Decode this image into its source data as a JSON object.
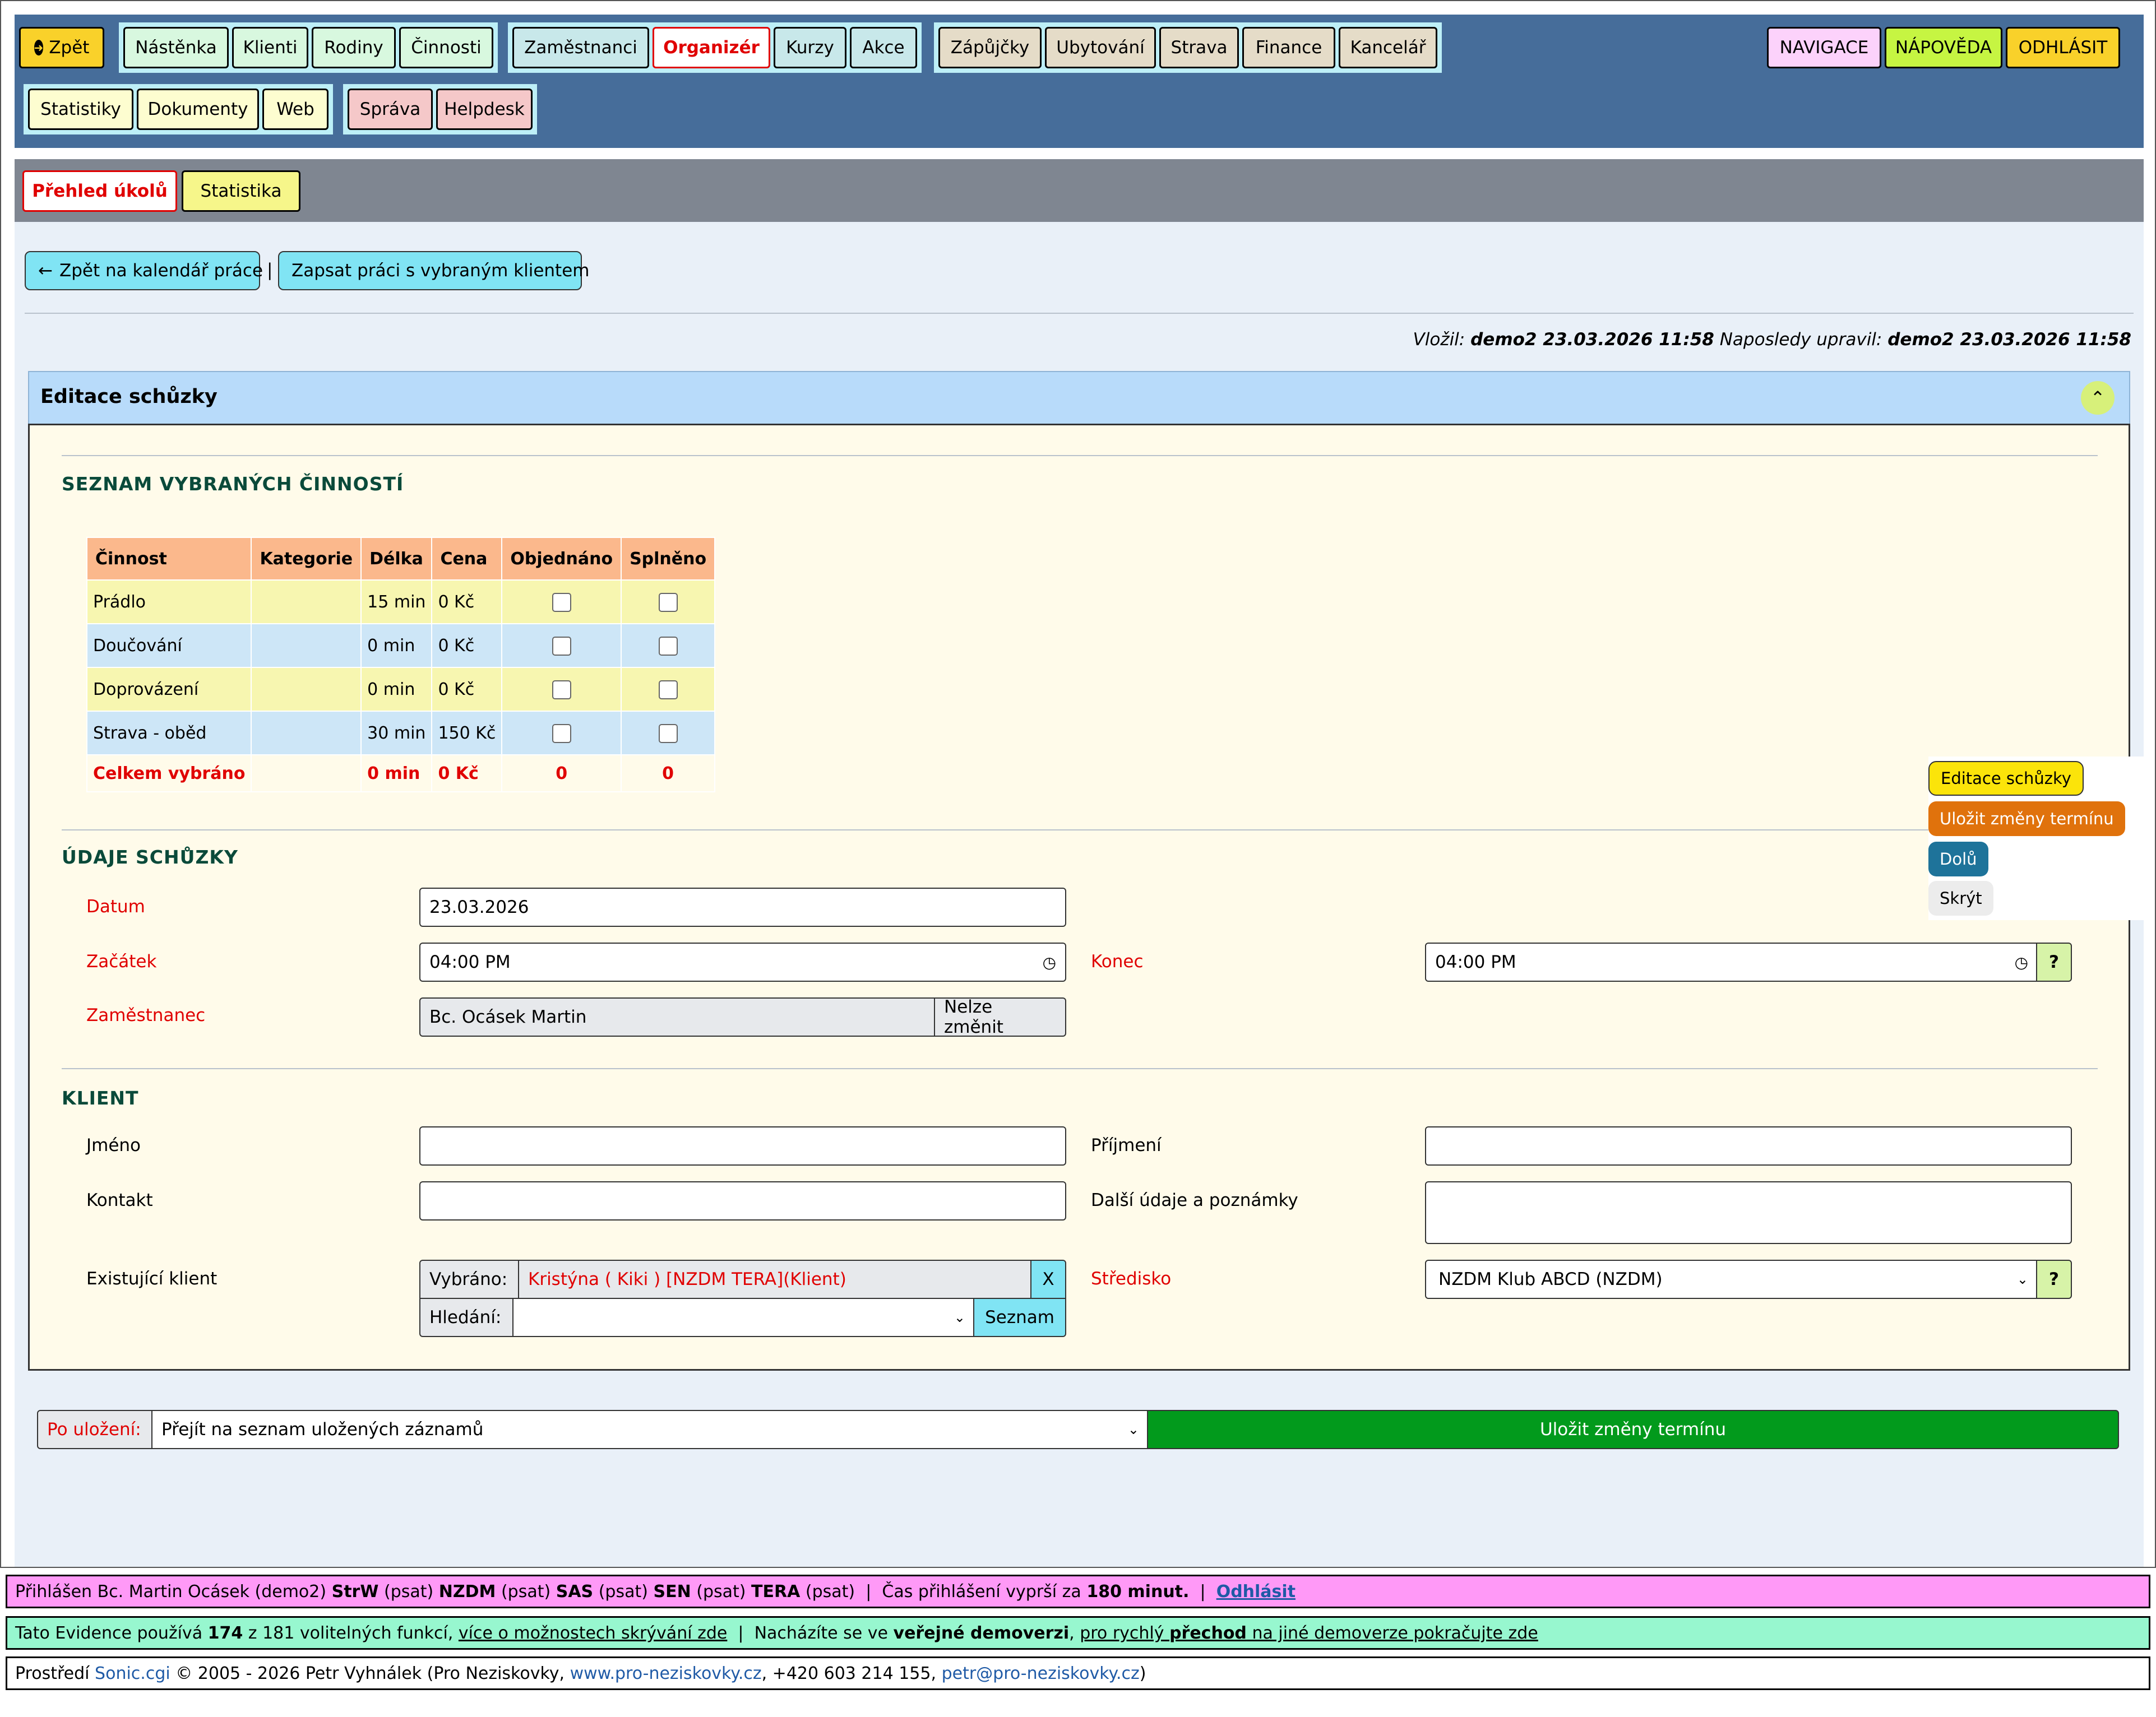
{
  "nav": {
    "back": "Zpět",
    "group1": [
      "Nástěnka",
      "Klienti",
      "Rodiny",
      "Činnosti"
    ],
    "group2": [
      "Zaměstnanci",
      "Organizér",
      "Kurzy",
      "Akce"
    ],
    "group3": [
      "Zápůjčky",
      "Ubytování",
      "Strava",
      "Finance",
      "Kancelář"
    ],
    "group4": [
      "Statistiky",
      "Dokumenty",
      "Web"
    ],
    "group5": [
      "Správa",
      "Helpdesk"
    ],
    "right": [
      "NAVIGACE",
      "NÁPOVĚDA",
      "ODHLÁSIT"
    ]
  },
  "subnav": {
    "overview": "Přehled úkolů",
    "stats": "Statistika"
  },
  "actions": {
    "back_calendar": "Zpět na kalendář práce",
    "separator": "|",
    "record_work": "Zapsat práci s vybraným klientem"
  },
  "meta": {
    "inserted_label": "Vložil:",
    "inserted_value": "demo2 23.03.2026 11:58",
    "modified_label": "Naposledy upravil:",
    "modified_value": "demo2 23.03.2026 11:58"
  },
  "panel": {
    "title": "Editace schůzky"
  },
  "activities": {
    "title": "SEZNAM VYBRANÝCH ČINNOSTÍ",
    "headers": [
      "Činnost",
      "Kategorie",
      "Délka",
      "Cena",
      "Objednáno",
      "Splněno"
    ],
    "rows": [
      {
        "name": "Prádlo",
        "category": "",
        "length": "15 min",
        "price": "0 Kč"
      },
      {
        "name": "Doučování",
        "category": "",
        "length": "0 min",
        "price": "0 Kč"
      },
      {
        "name": "Doprovázení",
        "category": "",
        "length": "0 min",
        "price": "0 Kč"
      },
      {
        "name": "Strava - oběd",
        "category": "",
        "length": "30 min",
        "price": "150 Kč"
      }
    ],
    "total": {
      "label": "Celkem vybráno",
      "length": "0 min",
      "price": "0 Kč",
      "ordered": "0",
      "done": "0"
    }
  },
  "meeting": {
    "title": "ÚDAJE SCHŮZKY",
    "date_label": "Datum",
    "date_value": "23.03.2026",
    "start_label": "Začátek",
    "start_value": "04:00 PM",
    "end_label": "Konec",
    "end_value": "04:00 PM",
    "employee_label": "Zaměstnanec",
    "employee_value": "Bc. Ocásek Martin",
    "employee_fixed": "Nelze změnit",
    "help": "?"
  },
  "client": {
    "title": "KLIENT",
    "firstname_label": "Jméno",
    "firstname_value": "",
    "surname_label": "Příjmení",
    "surname_value": "",
    "contact_label": "Kontakt",
    "contact_value": "",
    "notes_label": "Další údaje a poznámky",
    "notes_value": "",
    "existing_label": "Existující klient",
    "selected_label": "Vybráno:",
    "selected_value": "Kristýna ( Kiki ) [NZDM TERA](Klient)",
    "clear": "X",
    "search_label": "Hledání:",
    "search_value": "",
    "list_btn": "Seznam",
    "center_label": "Středisko",
    "center_value": "NZDM Klub ABCD (NZDM)",
    "help": "?"
  },
  "save": {
    "after_label": "Po uložení:",
    "after_value": "Přejít na seznam uložených záznamů",
    "save_btn": "Uložit změny termínu"
  },
  "float_menu": [
    "Editace schůzky",
    "Uložit změny termínu",
    "Dolů",
    "Skrýt"
  ],
  "footer": {
    "login_prefix": "Přihlášen Bc. Martin Ocásek (demo2)",
    "roles": [
      {
        "code": "StrW",
        "perm": "(psat)"
      },
      {
        "code": "NZDM",
        "perm": "(psat)"
      },
      {
        "code": "SAS",
        "perm": "(psat)"
      },
      {
        "code": "SEN",
        "perm": "(psat)"
      },
      {
        "code": "TERA",
        "perm": "(psat)"
      }
    ],
    "sep": "|",
    "expire_prefix": "Čas přihlášení vyprší za",
    "expire_value": "180 minut.",
    "logout": "Odhlásit",
    "uses_prefix": "Tato Evidence používá",
    "uses_count": "174",
    "uses_suffix": "z 181 volitelných funkcí,",
    "uses_link": "více o možnostech skrývání zde",
    "demo_prefix": "Nacházíte se ve",
    "demo_bold": "veřejné demoverzi",
    "demo_link_a": "pro rychlý",
    "demo_link_b": "přechod",
    "demo_link_c": "na jiné demoverze pokračujte zde",
    "env_prefix": "Prostředí",
    "env_sonic": "Sonic.cgi",
    "env_copy": "© 2005 - 2026 Petr Vyhnálek (Pro Neziskovky,",
    "env_web": "www.pro-neziskovky.cz",
    "env_phone": ", +420 603 214 155,",
    "env_email": "petr@pro-neziskovky.cz",
    "env_close": ")"
  },
  "colors": {
    "topnav": "#466d9a",
    "subbar": "#7f8691",
    "panel_header": "#b8dbfa",
    "panel_body": "#fffbea",
    "save_green": "#029a1c",
    "active_red": "#e00000"
  }
}
